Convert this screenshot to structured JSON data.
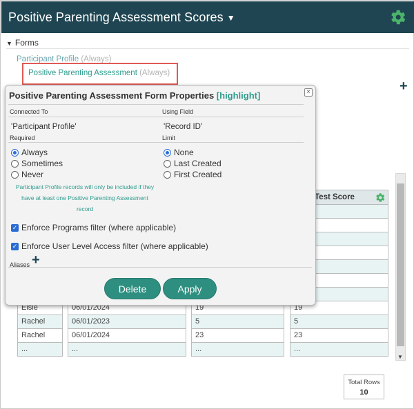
{
  "header": {
    "title": "Positive Parenting Assessment Scores",
    "caret": "▼",
    "gear_icon": "gear-icon"
  },
  "forms": {
    "section_label": "Forms",
    "toggle": "▼",
    "items": [
      {
        "name": "Participant Profile",
        "mode": "(Always)"
      },
      {
        "name": "Positive Parenting Assessment",
        "mode": "(Always)"
      }
    ],
    "add_symbol": "+"
  },
  "table": {
    "headers": [
      {
        "label": ""
      },
      {
        "label": ""
      },
      {
        "label": ""
      },
      {
        "label": "Test Score"
      }
    ],
    "blank_rows_before": 7,
    "rows": [
      [
        "Elsie",
        "06/01/2024",
        "19",
        "19"
      ],
      [
        "Rachel",
        "06/01/2023",
        "5",
        "5"
      ],
      [
        "Rachel",
        "06/01/2024",
        "23",
        "23"
      ],
      [
        "...",
        "...",
        "...",
        "..."
      ]
    ],
    "total_rows_label": "Total Rows",
    "total_rows_value": "10"
  },
  "dialog": {
    "title": "Positive Parenting Assessment Form Properties",
    "title_tag": "[highlight]",
    "close_symbol": "×",
    "connected_to_label": "Connected To",
    "connected_to_value": "'Participant Profile'",
    "using_field_label": "Using Field",
    "using_field_value": "'Record ID'",
    "required_label": "Required",
    "required_options": [
      {
        "label": "Always",
        "selected": true
      },
      {
        "label": "Sometimes",
        "selected": false
      },
      {
        "label": "Never",
        "selected": false
      }
    ],
    "limit_label": "Limit",
    "limit_options": [
      {
        "label": "None",
        "selected": true
      },
      {
        "label": "Last Created",
        "selected": false
      },
      {
        "label": "First Created",
        "selected": false
      }
    ],
    "note": "Participant Profile records will only be included if they have at least one Positive Parenting Assessment record",
    "programs_filter_label": "Enforce Programs filter (where applicable)",
    "programs_filter_checked": true,
    "user_level_filter_label": "Enforce User Level Access filter (where applicable)",
    "user_level_filter_checked": true,
    "aliases_label": "Aliases",
    "aliases_add": "+",
    "delete_label": "Delete",
    "apply_label": "Apply",
    "check_mark": "✓"
  },
  "colors": {
    "header_bg": "#1f4552",
    "accent_teal": "#2e9c8e",
    "button_bg": "#2e8f80",
    "highlight_border": "#e05a55",
    "radio_blue": "#2b6cd4"
  }
}
